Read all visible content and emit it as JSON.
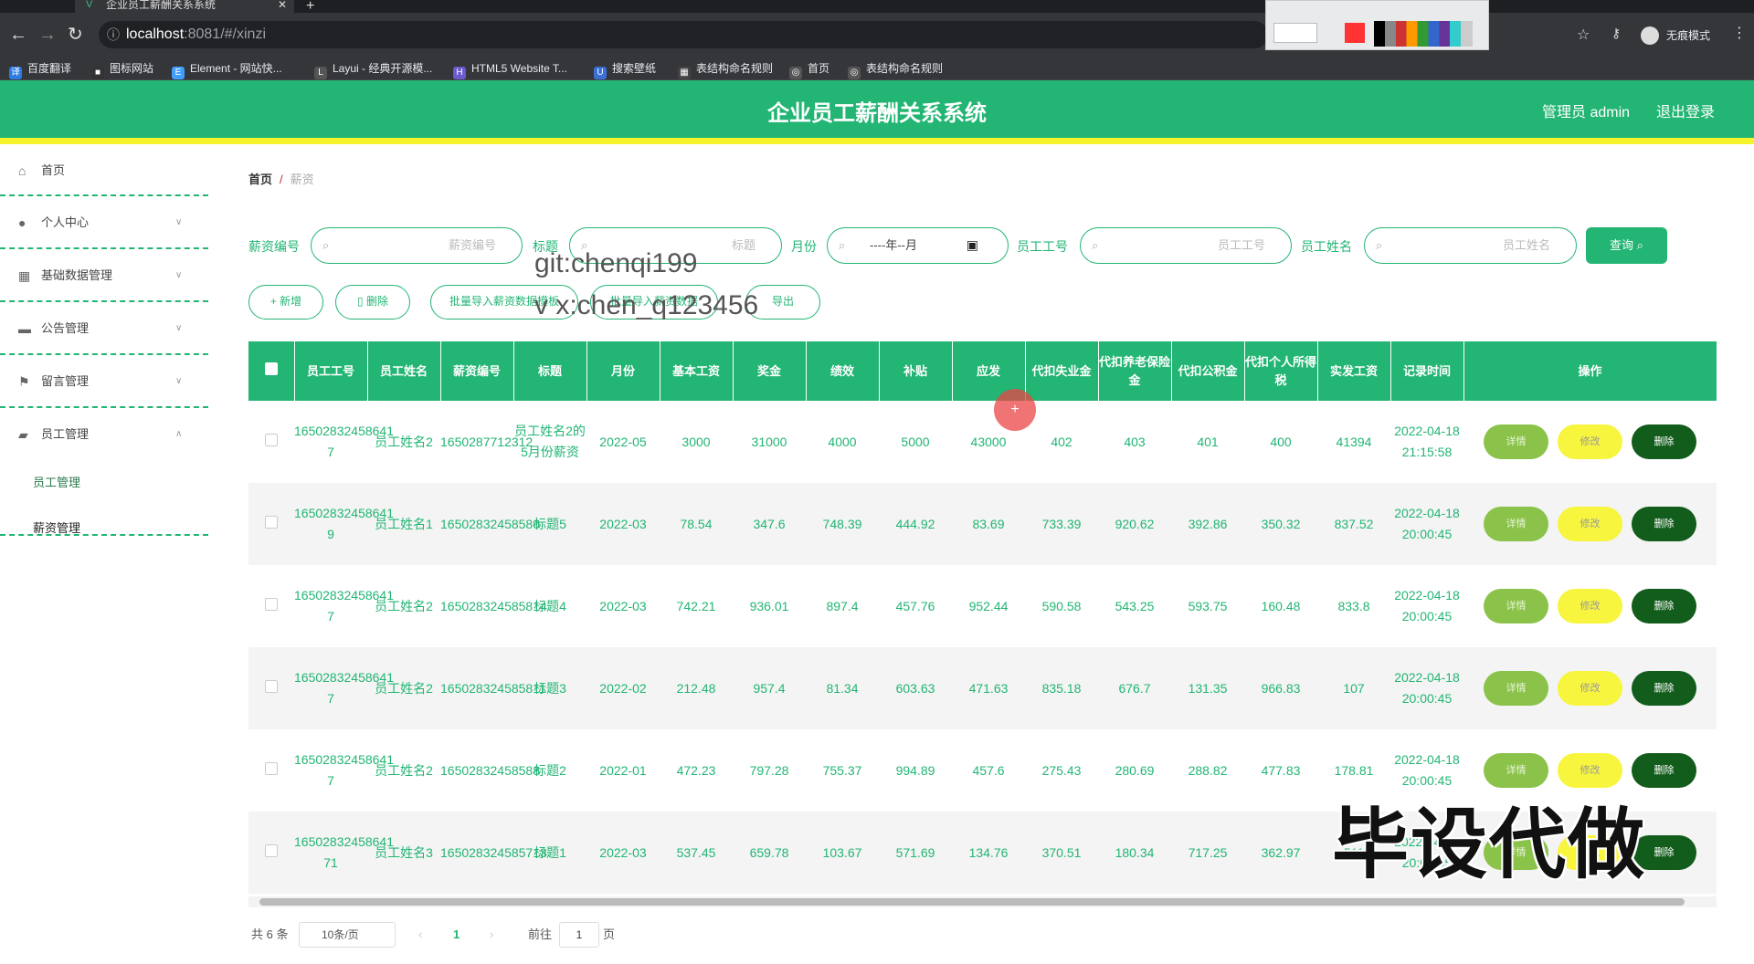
{
  "browser": {
    "tab_title": "企业员工薪酬关系系统",
    "url_host": "localhost",
    "url_path": ":8081/#/xinzi",
    "mode_label": "无痕模式",
    "bookmarks": [
      "百度翻译",
      "图标网站",
      "Element - 网站快...",
      "Layui - 经典开源模...",
      "HTML5 Website T...",
      "搜索壁纸",
      "表结构命名规则",
      "首页",
      "表结构命名规则"
    ]
  },
  "header": {
    "title": "企业员工薪酬关系系统",
    "admin": "管理员 admin",
    "logout": "退出登录"
  },
  "sidebar": {
    "items": [
      {
        "label": "首页",
        "icon": "home-icon"
      },
      {
        "label": "个人中心",
        "icon": "user-icon"
      },
      {
        "label": "基础数据管理",
        "icon": "grid-icon"
      },
      {
        "label": "公告管理",
        "icon": "monitor-icon"
      },
      {
        "label": "留言管理",
        "icon": "flag-icon"
      },
      {
        "label": "员工管理",
        "icon": "folder-icon"
      }
    ],
    "sub_items": [
      "员工管理",
      "薪资管理"
    ]
  },
  "breadcrumb": {
    "home": "首页",
    "sep": "/",
    "current": "薪资"
  },
  "filters": {
    "salary_no_label": "薪资编号",
    "salary_no_ph": "薪资编号",
    "title_label": "标题",
    "title_ph": "标题",
    "month_label": "月份",
    "month_ph": "----年--月",
    "emp_no_label": "员工工号",
    "emp_no_ph": "员工工号",
    "emp_name_label": "员工姓名",
    "emp_name_ph": "员工姓名",
    "query": "查询"
  },
  "actions": {
    "add": "+ 新增",
    "delete": "删除",
    "import": "批量导入薪资数据模板",
    "import2": "批量导入薪资数据",
    "export": "导出"
  },
  "watermark": {
    "line1": "git:chenqi199",
    "line2": "v x:chen_q123456",
    "big": "毕设代做"
  },
  "table": {
    "headers": [
      "员工工号",
      "员工姓名",
      "薪资编号",
      "标题",
      "月份",
      "基本工资",
      "奖金",
      "绩效",
      "补贴",
      "应发",
      "代扣失业金",
      "代扣养老保险金",
      "代扣公积金",
      "代扣个人所得税",
      "实发工资",
      "记录时间",
      "操作"
    ],
    "ops": {
      "detail": "详情",
      "edit": "修改",
      "del": "删除"
    },
    "rows": [
      [
        "16502832458641 7",
        "员工姓名2",
        "1650287712312",
        "员工姓名2的5月份薪资",
        "2022-05",
        "3000",
        "31000",
        "4000",
        "5000",
        "43000",
        "402",
        "403",
        "401",
        "400",
        "41394",
        "2022-04-18 21:15:58"
      ],
      [
        "16502832458641 9",
        "员工姓名1",
        "16502832458580",
        "标题5",
        "2022-03",
        "78.54",
        "347.6",
        "748.39",
        "444.92",
        "83.69",
        "733.39",
        "920.62",
        "392.86",
        "350.32",
        "837.52",
        "2022-04-18 20:00:45"
      ],
      [
        "16502832458641 7",
        "员工姓名2",
        "165028324585814",
        "标题4",
        "2022-03",
        "742.21",
        "936.01",
        "897.4",
        "457.76",
        "952.44",
        "590.58",
        "543.25",
        "593.75",
        "160.48",
        "833.8",
        "2022-04-18 20:00:45"
      ],
      [
        "16502832458641 7",
        "员工姓名2",
        "165028324585811",
        "标题3",
        "2022-02",
        "212.48",
        "957.4",
        "81.34",
        "603.63",
        "471.63",
        "835.18",
        "676.7",
        "131.35",
        "966.83",
        "107",
        "2022-04-18 20:00:45"
      ],
      [
        "16502832458641 7",
        "员工姓名2",
        "16502832458588",
        "标题2",
        "2022-01",
        "472.23",
        "797.28",
        "755.37",
        "994.89",
        "457.6",
        "275.43",
        "280.69",
        "288.82",
        "477.83",
        "178.81",
        "2022-04-18 20:00:45"
      ],
      [
        "16502832458641 71",
        "员工姓名3",
        "165028324585713",
        "标题1",
        "2022-03",
        "537.45",
        "659.78",
        "103.67",
        "571.69",
        "134.76",
        "370.51",
        "180.34",
        "717.25",
        "362.97",
        "511",
        "2022-04-18 20:00:45"
      ]
    ]
  },
  "pagination": {
    "total": "共 6 条",
    "size": "10条/页",
    "page": "1",
    "goto": "前往",
    "jump": "1",
    "unit": "页"
  },
  "colors": {
    "primary": "#22b573",
    "accent": "#f6f32a",
    "dark": "#125d1b"
  }
}
